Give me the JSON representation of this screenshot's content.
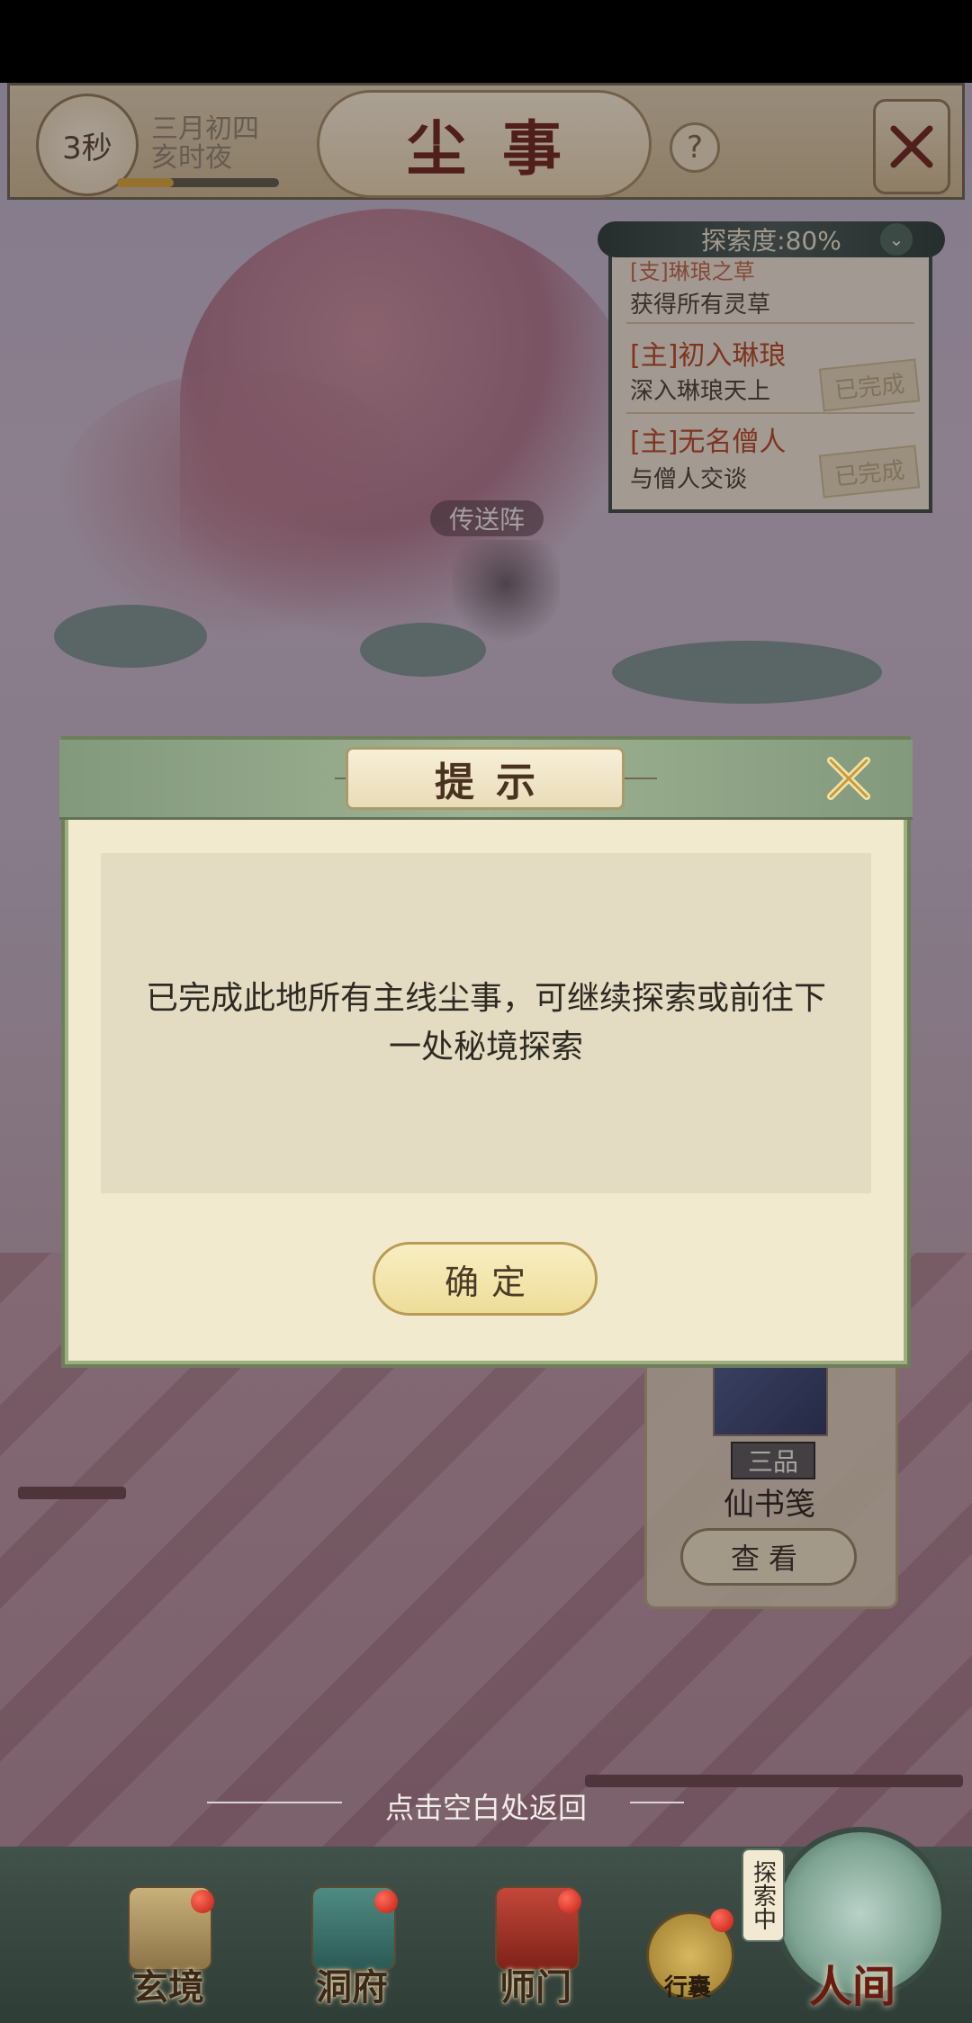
{
  "header": {
    "timer": "3秒",
    "date_line1": "三月初四",
    "date_line2": "亥时夜",
    "time_progress": 0.35,
    "title": "尘事",
    "help_icon": "question-icon",
    "close_icon": "close-x-icon"
  },
  "quest_panel": {
    "progress_label": "探索度:80%",
    "quests": [
      {
        "title": "[支]琳琅之草",
        "subtitle": "获得所有灵草",
        "status": ""
      },
      {
        "title": "[主]初入琳琅",
        "subtitle": "深入琳琅天上",
        "status": "已完成"
      },
      {
        "title": "[主]无名僧人",
        "subtitle": "与僧人交谈",
        "status": "已完成"
      }
    ]
  },
  "map": {
    "teleport_label": "传送阵"
  },
  "dialog": {
    "title": "提示",
    "message": "已完成此地所有主线尘事，可继续探索或前往下一处秘境探索",
    "confirm_label": "确定"
  },
  "item_card": {
    "grade": "三品",
    "name": "仙书笺",
    "view_label": "查看"
  },
  "return_hint": "点击空白处返回",
  "bottom_nav": {
    "items": [
      {
        "label": "玄境",
        "badge": true
      },
      {
        "label": "洞府",
        "badge": true
      },
      {
        "label": "师门",
        "badge": true
      }
    ],
    "bag_label": "行囊",
    "exploring_tag": "探索中",
    "world_label": "人间"
  },
  "colors": {
    "accent_gold": "#d4a83b",
    "quest_red": "#b34a26",
    "dialog_green": "#83997c"
  }
}
